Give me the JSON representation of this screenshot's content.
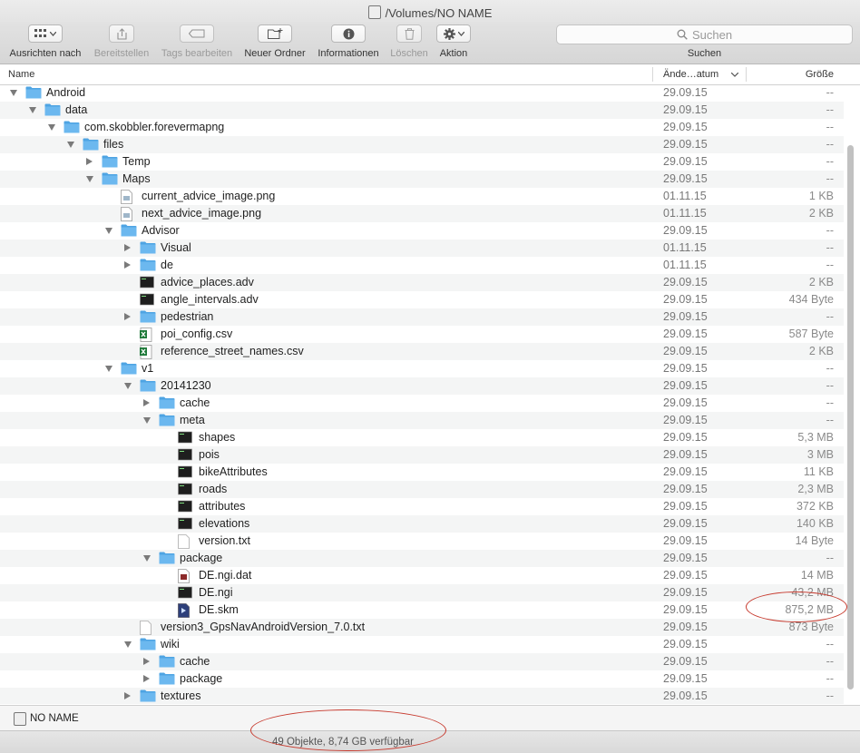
{
  "window": {
    "title": "/Volumes/NO NAME"
  },
  "toolbar": {
    "arrange_label": "Ausrichten nach",
    "share_label": "Bereitstellen",
    "tags_label": "Tags bearbeiten",
    "new_folder_label": "Neuer Ordner",
    "info_label": "Informationen",
    "delete_label": "Löschen",
    "action_label": "Aktion"
  },
  "search": {
    "placeholder": "Suchen",
    "label": "Suchen"
  },
  "columns": {
    "name": "Name",
    "date": "Ände…atum",
    "size": "Größe"
  },
  "rows": [
    {
      "name": "Android",
      "date": "29.09.15",
      "size": "--",
      "type": "folder",
      "level": 0,
      "disclosure": "open"
    },
    {
      "name": "data",
      "date": "29.09.15",
      "size": "--",
      "type": "folder",
      "level": 1,
      "disclosure": "open"
    },
    {
      "name": "com.skobbler.forevermapng",
      "date": "29.09.15",
      "size": "--",
      "type": "folder",
      "level": 2,
      "disclosure": "open"
    },
    {
      "name": "files",
      "date": "29.09.15",
      "size": "--",
      "type": "folder",
      "level": 3,
      "disclosure": "open"
    },
    {
      "name": "Temp",
      "date": "29.09.15",
      "size": "--",
      "type": "folder",
      "level": 4,
      "disclosure": "closed"
    },
    {
      "name": "Maps",
      "date": "29.09.15",
      "size": "--",
      "type": "folder",
      "level": 4,
      "disclosure": "open"
    },
    {
      "name": "current_advice_image.png",
      "date": "01.11.15",
      "size": "1 KB",
      "type": "image",
      "level": 5,
      "disclosure": "none"
    },
    {
      "name": "next_advice_image.png",
      "date": "01.11.15",
      "size": "2 KB",
      "type": "image",
      "level": 5,
      "disclosure": "none"
    },
    {
      "name": "Advisor",
      "date": "29.09.15",
      "size": "--",
      "type": "folder",
      "level": 5,
      "disclosure": "open"
    },
    {
      "name": "Visual",
      "date": "01.11.15",
      "size": "--",
      "type": "folder",
      "level": 6,
      "disclosure": "closed"
    },
    {
      "name": "de",
      "date": "01.11.15",
      "size": "--",
      "type": "folder",
      "level": 6,
      "disclosure": "closed"
    },
    {
      "name": "advice_places.adv",
      "date": "29.09.15",
      "size": "2 KB",
      "type": "exec",
      "level": 6,
      "disclosure": "none"
    },
    {
      "name": "angle_intervals.adv",
      "date": "29.09.15",
      "size": "434 Byte",
      "type": "exec",
      "level": 6,
      "disclosure": "none"
    },
    {
      "name": "pedestrian",
      "date": "29.09.15",
      "size": "--",
      "type": "folder",
      "level": 6,
      "disclosure": "closed"
    },
    {
      "name": "poi_config.csv",
      "date": "29.09.15",
      "size": "587 Byte",
      "type": "excel",
      "level": 6,
      "disclosure": "none"
    },
    {
      "name": "reference_street_names.csv",
      "date": "29.09.15",
      "size": "2 KB",
      "type": "excel",
      "level": 6,
      "disclosure": "none"
    },
    {
      "name": "v1",
      "date": "29.09.15",
      "size": "--",
      "type": "folder",
      "level": 5,
      "disclosure": "open"
    },
    {
      "name": "20141230",
      "date": "29.09.15",
      "size": "--",
      "type": "folder",
      "level": 6,
      "disclosure": "open"
    },
    {
      "name": "cache",
      "date": "29.09.15",
      "size": "--",
      "type": "folder",
      "level": 7,
      "disclosure": "closed"
    },
    {
      "name": "meta",
      "date": "29.09.15",
      "size": "--",
      "type": "folder",
      "level": 7,
      "disclosure": "open"
    },
    {
      "name": "shapes",
      "date": "29.09.15",
      "size": "5,3 MB",
      "type": "exec",
      "level": 8,
      "disclosure": "none"
    },
    {
      "name": "pois",
      "date": "29.09.15",
      "size": "3 MB",
      "type": "exec",
      "level": 8,
      "disclosure": "none"
    },
    {
      "name": "bikeAttributes",
      "date": "29.09.15",
      "size": "11 KB",
      "type": "exec",
      "level": 8,
      "disclosure": "none"
    },
    {
      "name": "roads",
      "date": "29.09.15",
      "size": "2,3 MB",
      "type": "exec",
      "level": 8,
      "disclosure": "none"
    },
    {
      "name": "attributes",
      "date": "29.09.15",
      "size": "372 KB",
      "type": "exec",
      "level": 8,
      "disclosure": "none"
    },
    {
      "name": "elevations",
      "date": "29.09.15",
      "size": "140 KB",
      "type": "exec",
      "level": 8,
      "disclosure": "none"
    },
    {
      "name": "version.txt",
      "date": "29.09.15",
      "size": "14 Byte",
      "type": "text",
      "level": 8,
      "disclosure": "none"
    },
    {
      "name": "package",
      "date": "29.09.15",
      "size": "--",
      "type": "folder",
      "level": 7,
      "disclosure": "open"
    },
    {
      "name": "DE.ngi.dat",
      "date": "29.09.15",
      "size": "14 MB",
      "type": "dat",
      "level": 8,
      "disclosure": "none"
    },
    {
      "name": "DE.ngi",
      "date": "29.09.15",
      "size": "43,2 MB",
      "type": "exec",
      "level": 8,
      "disclosure": "none"
    },
    {
      "name": "DE.skm",
      "date": "29.09.15",
      "size": "875,2 MB",
      "type": "skm",
      "level": 8,
      "disclosure": "none"
    },
    {
      "name": "version3_GpsNavAndroidVersion_7.0.txt",
      "date": "29.09.15",
      "size": "873 Byte",
      "type": "text",
      "level": 6,
      "disclosure": "none"
    },
    {
      "name": "wiki",
      "date": "29.09.15",
      "size": "--",
      "type": "folder",
      "level": 6,
      "disclosure": "open"
    },
    {
      "name": "cache",
      "date": "29.09.15",
      "size": "--",
      "type": "folder",
      "level": 7,
      "disclosure": "closed"
    },
    {
      "name": "package",
      "date": "29.09.15",
      "size": "--",
      "type": "folder",
      "level": 7,
      "disclosure": "closed"
    },
    {
      "name": "textures",
      "date": "29.09.15",
      "size": "--",
      "type": "folder",
      "level": 6,
      "disclosure": "closed"
    }
  ],
  "pathbar": {
    "volume": "NO NAME"
  },
  "status": {
    "text": "49 Objekte, 8,74 GB verfügbar"
  },
  "colors": {
    "folder": "#5aa9e6",
    "annotation": "#c73a2e",
    "row_alt": "#f4f5f5"
  }
}
